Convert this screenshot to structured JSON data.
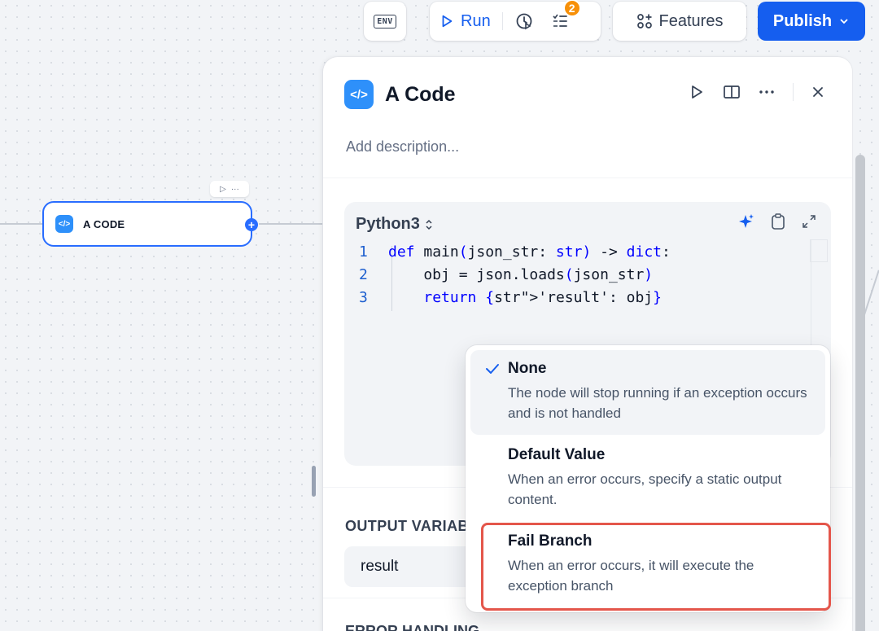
{
  "toolbar": {
    "env_label": "ENV",
    "run_label": "Run",
    "checklist_badge": "2",
    "features_label": "Features",
    "publish_label": "Publish"
  },
  "canvas": {
    "node_title": "A CODE"
  },
  "panel": {
    "title": "A Code",
    "description_placeholder": "Add description...",
    "code": {
      "language": "Python3",
      "lines": [
        {
          "n": "1",
          "text": "def main(json_str: str) -> dict:"
        },
        {
          "n": "2",
          "text": "    obj = json.loads(json_str)"
        },
        {
          "n": "3",
          "text": "    return {'result': obj}"
        }
      ]
    },
    "output_label": "OUTPUT VARIABLES",
    "output_var": "result",
    "error_label": "ERROR HANDLING"
  },
  "dropdown": {
    "options": [
      {
        "title": "None",
        "desc": "The node will stop running if an exception occurs and is not handled",
        "selected": true
      },
      {
        "title": "Default Value",
        "desc": "When an error occurs, specify a static output content.",
        "selected": false
      },
      {
        "title": "Fail Branch",
        "desc": "When an error occurs, it will execute the exception branch",
        "selected": false
      }
    ]
  },
  "colors": {
    "primary": "#155eef",
    "badge": "#f79009",
    "highlight": "#e4564b",
    "node_border": "#296dff"
  }
}
